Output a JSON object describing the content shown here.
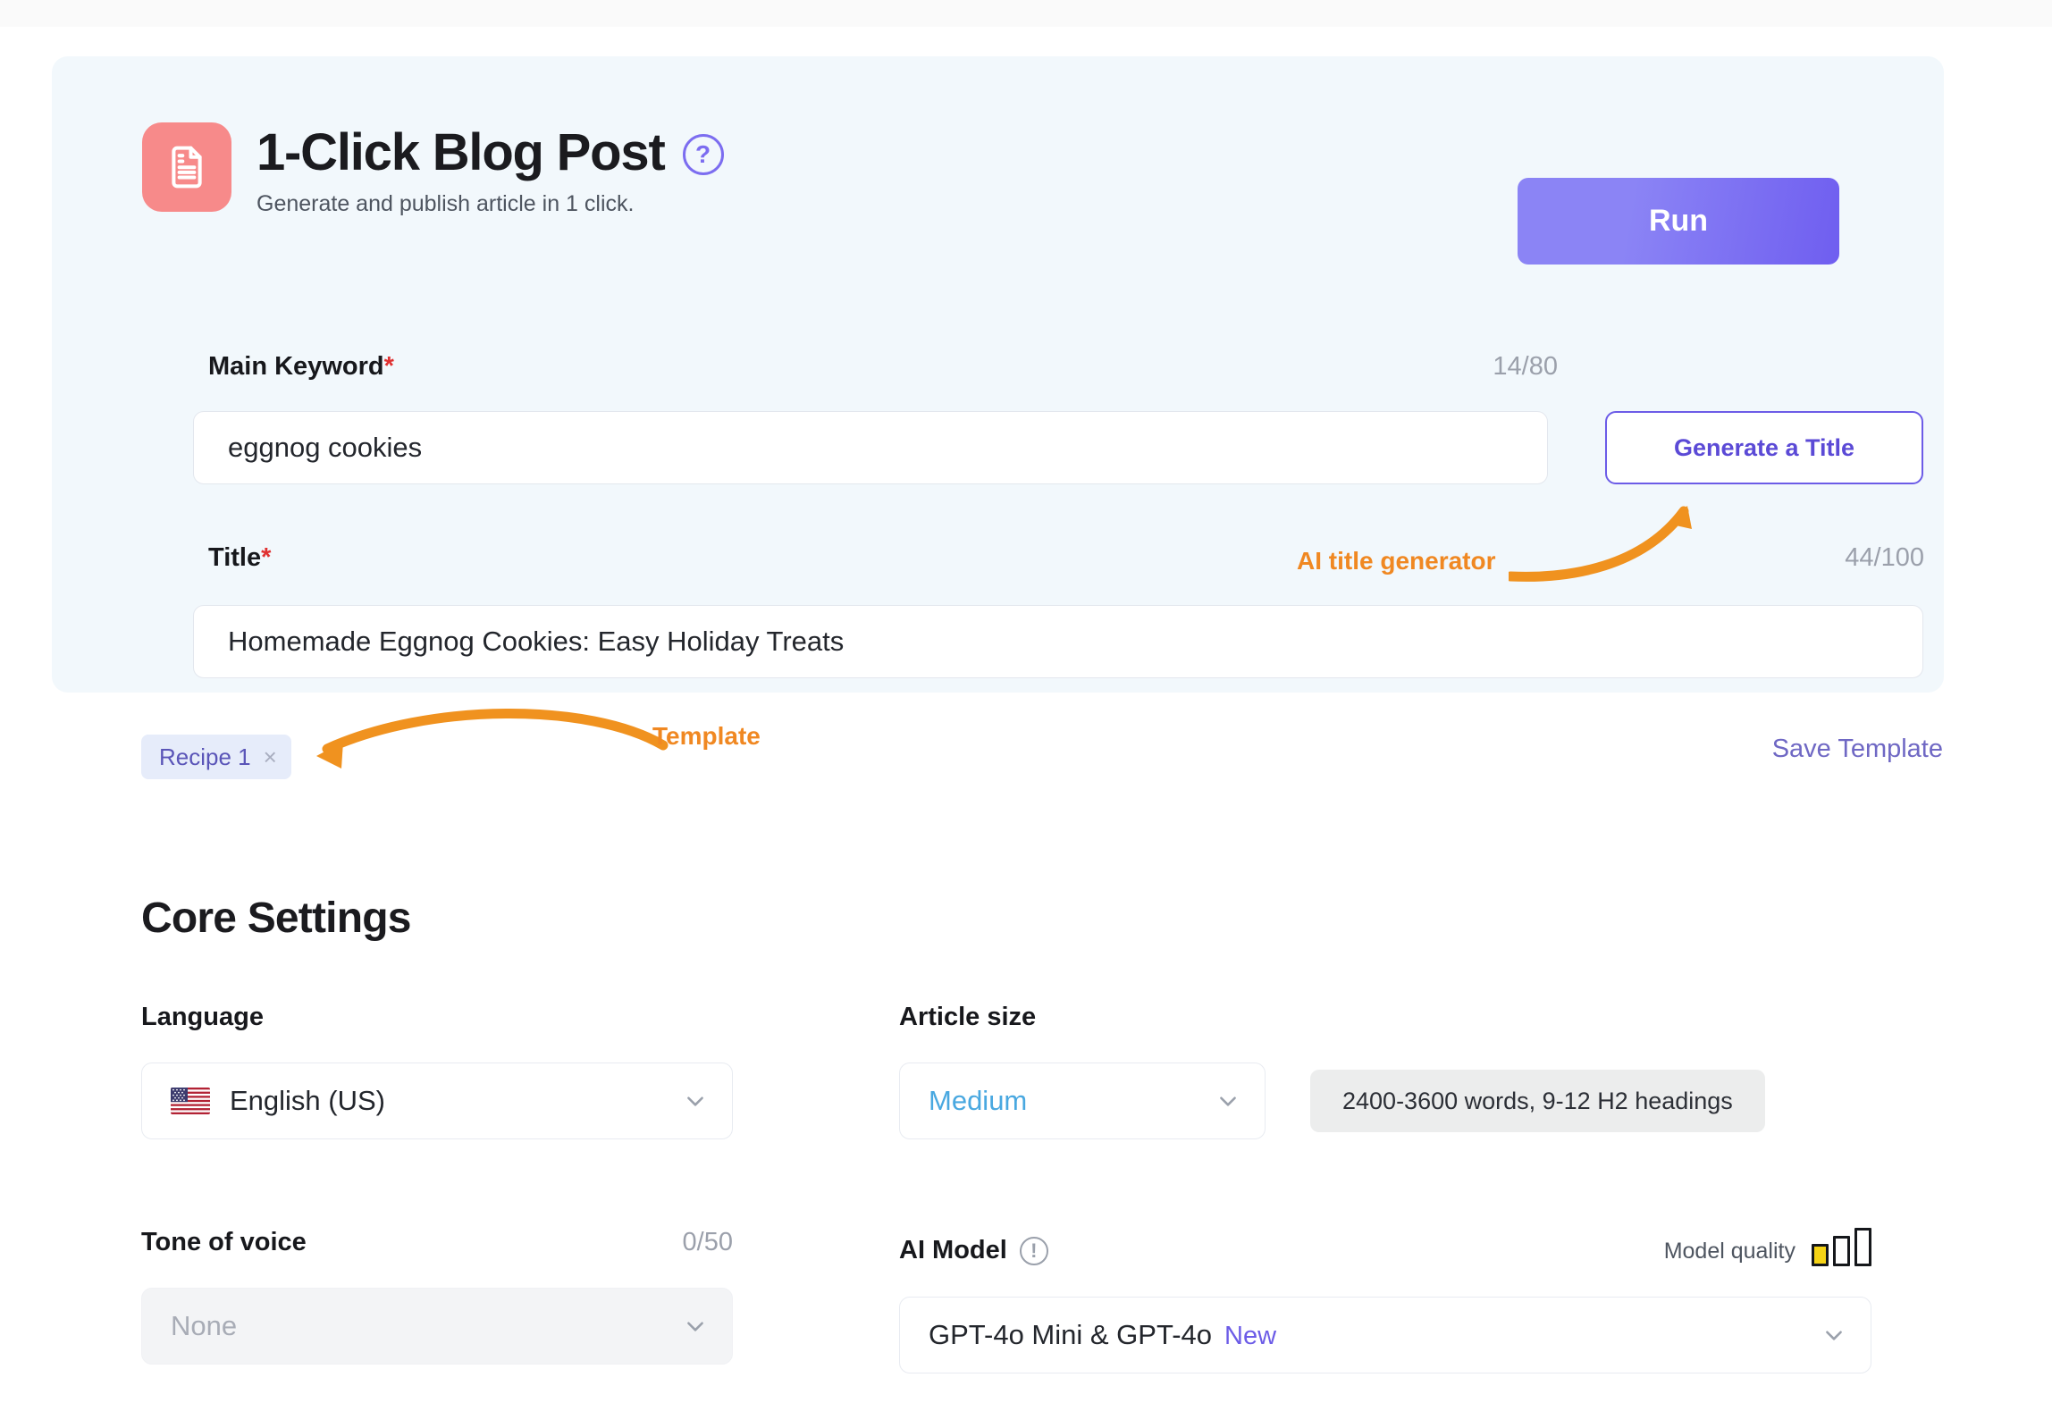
{
  "app": {
    "icon_name": "document-icon",
    "title": "1-Click Blog Post",
    "subtitle": "Generate and publish article in 1 click.",
    "help_icon_glyph": "?",
    "run_label": "Run",
    "accent_purple": "#6c5ce7",
    "icon_tile_color": "#f78a8a",
    "card_background": "#f2f8fc"
  },
  "main_keyword": {
    "label": "Main Keyword",
    "required_mark": "*",
    "counter": "14/80",
    "value": "eggnog cookies",
    "placeholder": "Main Keyword"
  },
  "generate_title_button": {
    "label": "Generate a Title"
  },
  "title_field": {
    "label": "Title",
    "required_mark": "*",
    "counter": "44/100",
    "value": "Homemade Eggnog Cookies: Easy Holiday Treats",
    "placeholder": "Title"
  },
  "annotations": {
    "ai_title_generator": "AI title generator",
    "template": "Template",
    "color": "#f08822"
  },
  "template_row": {
    "chip_label": "Recipe 1",
    "chip_close_glyph": "×",
    "save_label": "Save Template"
  },
  "core_settings": {
    "heading": "Core Settings",
    "language": {
      "label": "Language",
      "value": "English (US)",
      "flag_name": "us-flag-icon"
    },
    "article_size": {
      "label": "Article size",
      "value": "Medium",
      "hint": "2400-3600 words, 9-12 H2 headings"
    },
    "tone_of_voice": {
      "label": "Tone of voice",
      "counter": "0/50",
      "value": "None"
    },
    "ai_model": {
      "label": "AI Model",
      "info_glyph": "!",
      "quality_label": "Model quality",
      "quality_filled": 1,
      "quality_total": 3,
      "quality_color": "#f5d316",
      "value": "GPT-4o Mini & GPT-4o",
      "badge": "New"
    }
  }
}
